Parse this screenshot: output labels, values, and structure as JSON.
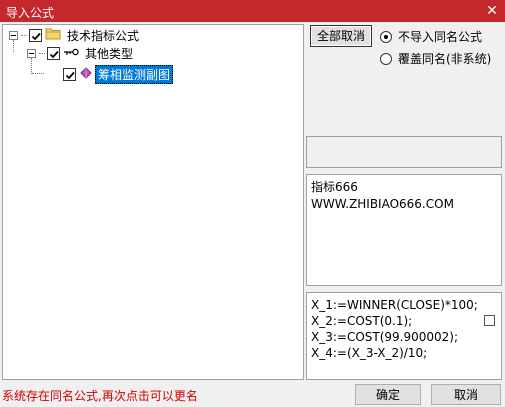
{
  "window": {
    "title": "导入公式",
    "close_glyph": "✕"
  },
  "tree": {
    "root": {
      "label": "技术指标公式"
    },
    "child": {
      "label": "其他类型"
    },
    "leaf": {
      "label": "筹相监测副图"
    }
  },
  "buttons": {
    "cancel_all": "全部取消",
    "ok": "确定",
    "cancel": "取消"
  },
  "options": {
    "no_import_same": "不导入同名公式",
    "overwrite_same": "覆盖同名(非系统)",
    "selected": "no_import_same"
  },
  "info": {
    "line1": "指标666",
    "line2": "WWW.ZHIBIAO666.COM"
  },
  "code": {
    "lines": [
      "X_1:=WINNER(CLOSE)*100;",
      "X_2:=COST(0.1);",
      "X_3:=COST(99.900002);",
      "X_4:=(X_3-X_2)/10;"
    ]
  },
  "status": {
    "message": "系统存在同名公式,再次点击可以更名"
  },
  "colors": {
    "titlebar": "#c4282d",
    "selected_bg": "#0078d7",
    "status_text": "#d00000"
  }
}
